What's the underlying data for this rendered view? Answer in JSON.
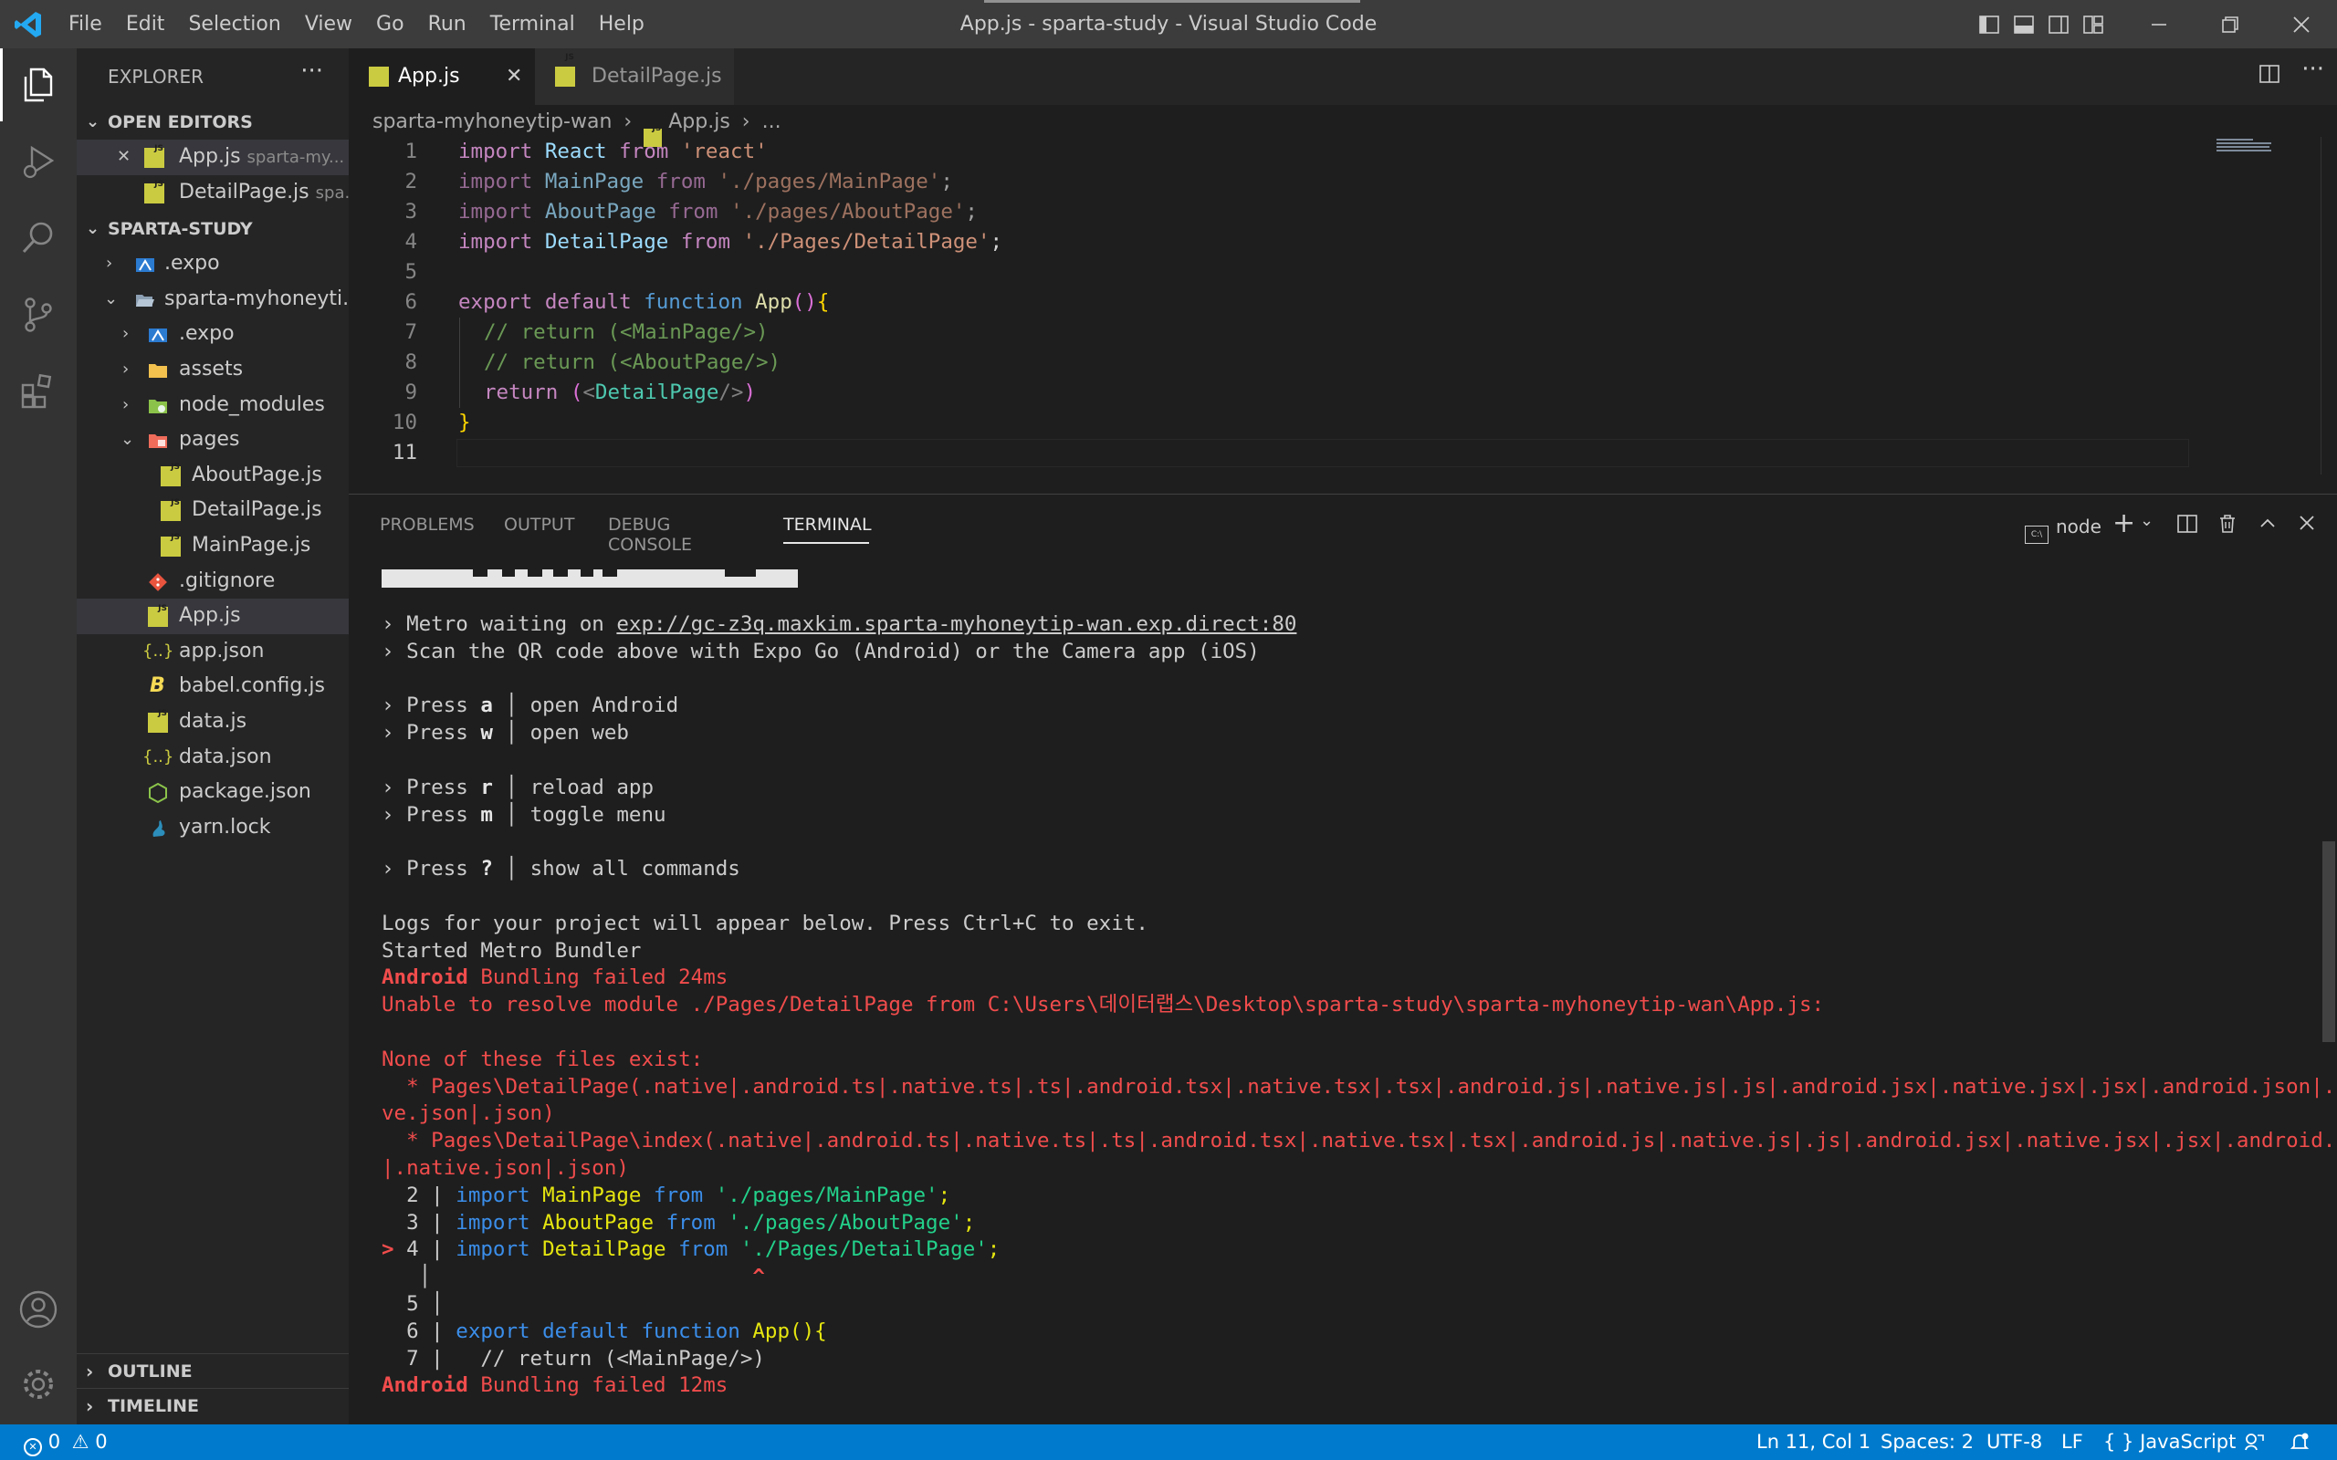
{
  "window_title": "App.js - sparta-study - Visual Studio Code",
  "menu": [
    "File",
    "Edit",
    "Selection",
    "View",
    "Go",
    "Run",
    "Terminal",
    "Help"
  ],
  "explorer": {
    "title": "EXPLORER",
    "open_editors_label": "OPEN EDITORS",
    "open_editors": [
      {
        "name": "App.js",
        "desc": "sparta-my..."
      },
      {
        "name": "DetailPage.js",
        "desc": "spa..."
      }
    ],
    "project_label": "SPARTA-STUDY",
    "tree": [
      ".expo",
      "sparta-myhoneyti...",
      ".expo",
      "assets",
      "node_modules",
      "pages",
      "AboutPage.js",
      "DetailPage.js",
      "MainPage.js",
      ".gitignore",
      "App.js",
      "app.json",
      "babel.config.js",
      "data.js",
      "data.json",
      "package.json",
      "yarn.lock"
    ],
    "outline_label": "OUTLINE",
    "timeline_label": "TIMELINE"
  },
  "tabs": [
    {
      "label": "App.js"
    },
    {
      "label": "DetailPage.js"
    }
  ],
  "breadcrumb": {
    "folder": "sparta-myhoneytip-wan",
    "file": "App.js",
    "rest": "..."
  },
  "line_numbers": [
    "1",
    "2",
    "3",
    "4",
    "5",
    "6",
    "7",
    "8",
    "9",
    "10",
    "11"
  ],
  "code": {
    "l1": {
      "kw": "import",
      "id": "React",
      "from": "from",
      "str": "'react'"
    },
    "l2": {
      "kw": "import",
      "id": "MainPage",
      "from": "from",
      "str": "'./pages/MainPage'",
      "end": ";"
    },
    "l3": {
      "kw": "import",
      "id": "AboutPage",
      "from": "from",
      "str": "'./pages/AboutPage'",
      "end": ";"
    },
    "l4": {
      "kw": "import",
      "id": "DetailPage",
      "from": "from",
      "str": "'./Pages/DetailPage'",
      "end": ";"
    },
    "l6": {
      "export": "export",
      "default": "default",
      "function": "function",
      "name": "App",
      "parens": "()",
      "brace": "{"
    },
    "l7": "// return (<MainPage/>)",
    "l8": "// return (<AboutPage/>)",
    "l9": {
      "ret": "return",
      "open": "(",
      "lt": "<",
      "tag": "DetailPage",
      "close_tag": "/>",
      "close": ")"
    },
    "l10": "}"
  },
  "panel": {
    "tabs": [
      "PROBLEMS",
      "OUTPUT",
      "DEBUG CONSOLE",
      "TERMINAL"
    ],
    "terminal_name": "node"
  },
  "terminal": {
    "metro_prefix": "› Metro waiting on ",
    "metro_url": "exp://gc-z3q.maxkim.sparta-myhoneytip-wan.exp.direct:80",
    "scan": "› Scan the QR code above with Expo Go (Android) or the Camera app (iOS)",
    "press": "› Press ",
    "keys": [
      {
        "k": "a",
        "desc": "open Android"
      },
      {
        "k": "w",
        "desc": "open web"
      },
      {
        "k": "r",
        "desc": "reload app"
      },
      {
        "k": "m",
        "desc": "toggle menu"
      },
      {
        "k": "?",
        "desc": "show all commands"
      }
    ],
    "logs": "Logs for your project will appear below. Press Ctrl+C to exit.",
    "started": "Started Metro Bundler",
    "android": "Android",
    "bundling_failed_1": " Bundling failed 24ms",
    "unable": "Unable to resolve module ./Pages/DetailPage from C:\\Users\\데이터랩스\\Desktop\\sparta-study\\sparta-myhoneytip-wan\\App.js:",
    "none_exist": "None of these files exist:",
    "e1a": "  * Pages\\DetailPage(.native|.android.ts|.native.ts|.ts|.android.tsx|.native.tsx|.tsx|.android.js|.native.js|.js|.android.jsx|.native.jsx|.jsx|.android.json|.nati",
    "e1b": "ve.json|.json)",
    "e2a": "  * Pages\\DetailPage\\index(.native|.android.ts|.native.ts|.ts|.android.tsx|.native.tsx|.tsx|.android.js|.native.js|.js|.android.jsx|.native.jsx|.jsx|.android.json",
    "e2b": "|.native.json|.json)",
    "snip": {
      "n2": "2",
      "n3": "3",
      "n4": "4",
      "n5": "5",
      "n6": "6",
      "n7": "7",
      "arrow": ">",
      "sep": " | ",
      "imp": "import",
      "from": "from",
      "s2id": "MainPage",
      "s2str": "'./pages/MainPage'",
      "s3id": "AboutPage",
      "s3str": "'./pages/AboutPage'",
      "s4id": "DetailPage",
      "s4str": "'./Pages/DetailPage'",
      "semi": ";",
      "caret": "^",
      "s6": "export default function",
      "s6fn": "App",
      "s6p": "(){",
      "s7": "  // return (<MainPage/>)"
    },
    "bundling_failed_2": " Bundling failed 12ms"
  },
  "status": {
    "errors": "0",
    "warnings": "0",
    "position": "Ln 11, Col 1",
    "spaces": "Spaces: 2",
    "encoding": "UTF-8",
    "eol": "LF",
    "language": "JavaScript",
    "language_icon": "{ }"
  },
  "colors": {
    "accent": "#007acc",
    "js_icon": "#cbcb41",
    "error": "#f14c4c"
  }
}
